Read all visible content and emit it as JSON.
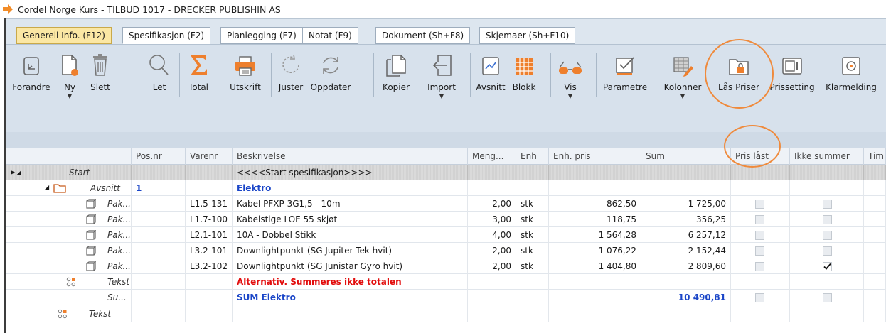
{
  "window": {
    "title": "Cordel Norge Kurs - TILBUD 1017 - DRECKER PUBLISHIN AS"
  },
  "tabs": [
    {
      "label": "Generell Info. (F12)"
    },
    {
      "label": "Spesifikasjon (F2)"
    },
    {
      "label": "Planlegging (F7)"
    },
    {
      "label": "Notat (F9)"
    },
    {
      "label": "Dokument (Sh+F8)"
    },
    {
      "label": "Skjemaer (Sh+F10)"
    }
  ],
  "toolbar": {
    "forandre": "Forandre",
    "ny": "Ny",
    "slett": "Slett",
    "let": "Let",
    "total": "Total",
    "utskrift": "Utskrift",
    "juster": "Juster",
    "oppdater": "Oppdater",
    "kopier": "Kopier",
    "import": "Import",
    "avsnitt": "Avsnitt",
    "blokk": "Blokk",
    "vis": "Vis",
    "parametre": "Parametre",
    "kolonner": "Kolonner",
    "las_priser": "Lås Priser",
    "prissetting": "Prissetting",
    "klarmelding": "Klarmelding"
  },
  "colors": {
    "accent": "#ef8a3c",
    "link_blue": "#1b46c8",
    "alert_red": "#e20d0d",
    "active_tab": "#fbe7a4"
  },
  "grid": {
    "columns": [
      "Pos.nr",
      "Varenr",
      "Beskrivelse",
      "Meng...",
      "Enh",
      "Enh. pris",
      "Sum",
      "Pris låst",
      "Ikke summer",
      "Tim"
    ],
    "rows": [
      {
        "type": "Start",
        "pos": "",
        "varenr": "",
        "desc": "<<<<Start spesifikasjon>>>>",
        "meng": "",
        "enh": "",
        "pris": "",
        "sum": ""
      },
      {
        "type": "Avsnitt",
        "pos": "1",
        "varenr": "",
        "desc": "Elektro",
        "meng": "",
        "enh": "",
        "pris": "",
        "sum": ""
      },
      {
        "type": "Pak...",
        "pos": "",
        "varenr": "L1.5-131",
        "desc": "Kabel PFXP 3G1,5 - 10m",
        "meng": "2,00",
        "enh": "stk",
        "pris": "862,50",
        "sum": "1 725,00"
      },
      {
        "type": "Pak...",
        "pos": "",
        "varenr": "L1.7-100",
        "desc": "Kabelstige LOE 55 skjøt",
        "meng": "3,00",
        "enh": "stk",
        "pris": "118,75",
        "sum": "356,25"
      },
      {
        "type": "Pak...",
        "pos": "",
        "varenr": "L2.1-101",
        "desc": "10A - Dobbel Stikk",
        "meng": "4,00",
        "enh": "stk",
        "pris": "1 564,28",
        "sum": "6 257,12"
      },
      {
        "type": "Pak...",
        "pos": "",
        "varenr": "L3.2-101",
        "desc": "Downlightpunkt (SG Jupiter Tek hvit)",
        "meng": "2,00",
        "enh": "stk",
        "pris": "1 076,22",
        "sum": "2 152,44"
      },
      {
        "type": "Pak...",
        "pos": "",
        "varenr": "L3.2-102",
        "desc": "Downlightpunkt (SG Junistar Gyro hvit)",
        "meng": "2,00",
        "enh": "stk",
        "pris": "1 404,80",
        "sum": "2 809,60"
      },
      {
        "type": "Tekst",
        "pos": "",
        "varenr": "",
        "desc": "Alternativ. Summeres ikke totalen",
        "meng": "",
        "enh": "",
        "pris": "",
        "sum": ""
      },
      {
        "type": "Su...",
        "pos": "",
        "varenr": "",
        "desc": "SUM Elektro",
        "meng": "",
        "enh": "",
        "pris": "",
        "sum": "10 490,81"
      },
      {
        "type": "Tekst",
        "pos": "",
        "varenr": "",
        "desc": "",
        "meng": "",
        "enh": "",
        "pris": "",
        "sum": ""
      }
    ],
    "ikke_summer_checked_row": 6
  }
}
